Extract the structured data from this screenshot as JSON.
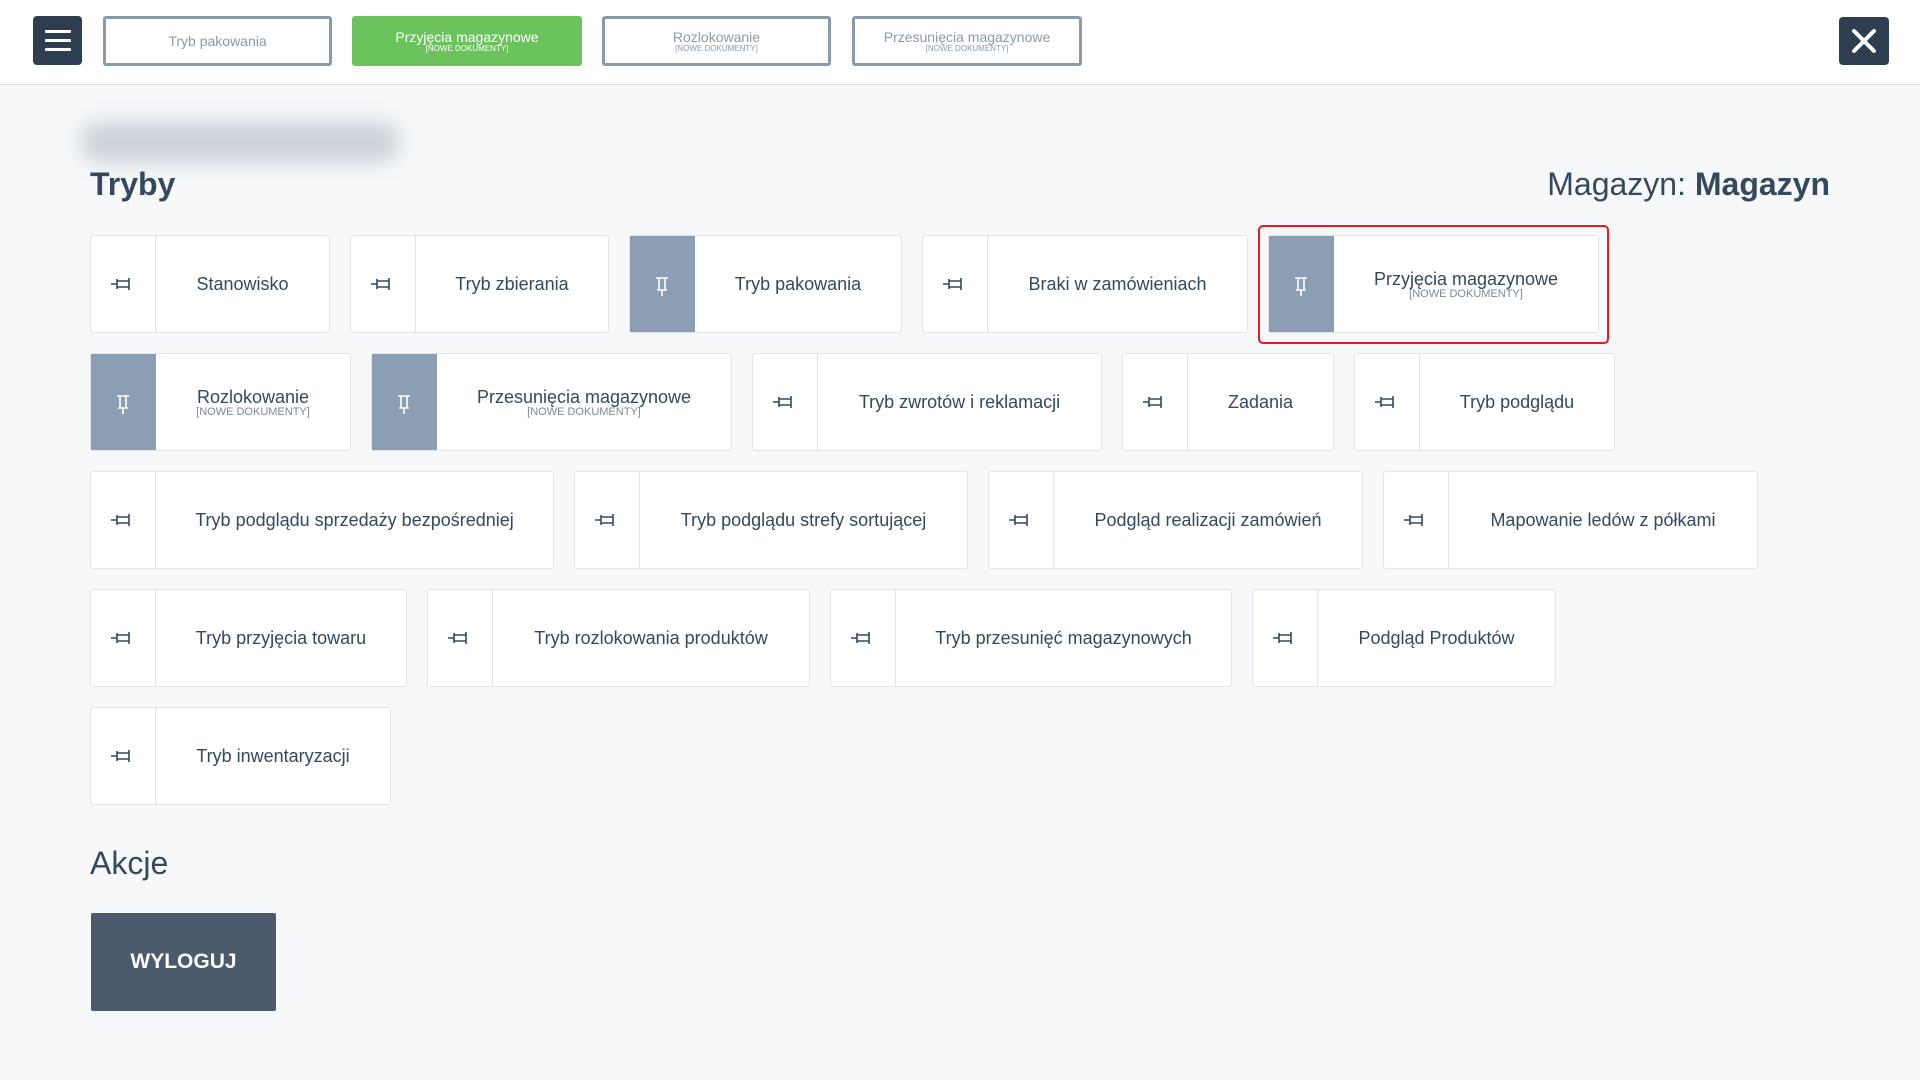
{
  "topbar": {
    "tabs": [
      {
        "label": "Tryb pakowania",
        "sub": "",
        "active": false
      },
      {
        "label": "Przyjęcia magazynowe",
        "sub": "[NOWE DOKUMENTY]",
        "active": true
      },
      {
        "label": "Rozlokowanie",
        "sub": "[NOWE DOKUMENTY]",
        "active": false
      },
      {
        "label": "Przesunięcia magazynowe",
        "sub": "[NOWE DOKUMENTY]",
        "active": false
      }
    ],
    "menu_icon": "hamburger-icon",
    "close_icon": "close-icon"
  },
  "modes": {
    "title": "Tryby",
    "warehouse_label": "Magazyn:",
    "warehouse_name": "Magazyn",
    "tiles": [
      {
        "label": "Stanowisko",
        "sub": "",
        "pinned": false
      },
      {
        "label": "Tryb zbierania",
        "sub": "",
        "pinned": false
      },
      {
        "label": "Tryb pakowania",
        "sub": "",
        "pinned": true
      },
      {
        "label": "Braki w zamówieniach",
        "sub": "",
        "pinned": false
      },
      {
        "label": "Przyjęcia magazynowe",
        "sub": "[NOWE DOKUMENTY]",
        "pinned": true
      },
      {
        "label": "Rozlokowanie",
        "sub": "[NOWE DOKUMENTY]",
        "pinned": true
      },
      {
        "label": "Przesunięcia magazynowe",
        "sub": "[NOWE DOKUMENTY]",
        "pinned": true
      },
      {
        "label": "Tryb zwrotów i reklamacji",
        "sub": "",
        "pinned": false
      },
      {
        "label": "Zadania",
        "sub": "",
        "pinned": false
      },
      {
        "label": "Tryb podglądu",
        "sub": "",
        "pinned": false
      },
      {
        "label": "Tryb podglądu sprzedaży bezpośredniej",
        "sub": "",
        "pinned": false
      },
      {
        "label": "Tryb podglądu strefy sortującej",
        "sub": "",
        "pinned": false
      },
      {
        "label": "Podgląd realizacji zamówień",
        "sub": "",
        "pinned": false
      },
      {
        "label": "Mapowanie ledów z półkami",
        "sub": "",
        "pinned": false
      },
      {
        "label": "Tryb przyjęcia towaru",
        "sub": "",
        "pinned": false
      },
      {
        "label": "Tryb rozlokowania produktów",
        "sub": "",
        "pinned": false
      },
      {
        "label": "Tryb przesunięć magazynowych",
        "sub": "",
        "pinned": false
      },
      {
        "label": "Podgląd Produktów",
        "sub": "",
        "pinned": false
      },
      {
        "label": "Tryb inwentaryzacji",
        "sub": "",
        "pinned": false
      }
    ]
  },
  "actions": {
    "title": "Akcje",
    "logout_label": "WYLOGUJ"
  },
  "colors": {
    "active_tab": "#6cc35e",
    "pinned_tile": "#8b9eb3",
    "dark": "#2c3e50",
    "highlight": "#e01e28"
  }
}
